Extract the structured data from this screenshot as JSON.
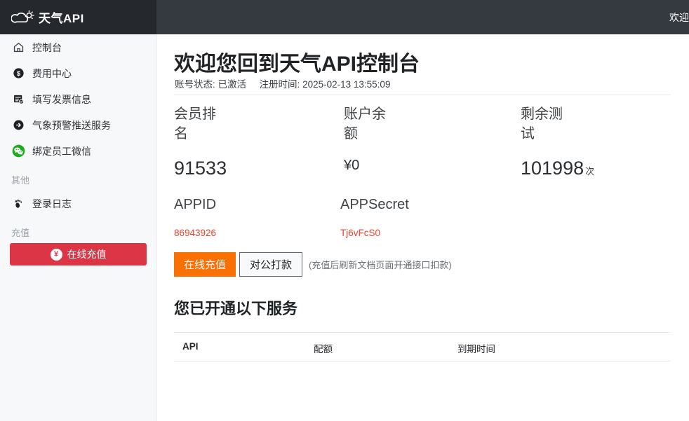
{
  "brand": {
    "name": "天气API",
    "icon": "cloud-sun-icon"
  },
  "topbar": {
    "greeting": "欢迎"
  },
  "sidebar": {
    "items": [
      {
        "label": "控制台",
        "icon": "home-icon"
      },
      {
        "label": "费用中心",
        "icon": "dollar-circle-icon"
      },
      {
        "label": "填写发票信息",
        "icon": "invoice-form-icon"
      },
      {
        "label": "气象预警推送服务",
        "icon": "arrow-right-circle-icon"
      },
      {
        "label": "绑定员工微信",
        "icon": "wechat-icon"
      }
    ],
    "group_other": "其他",
    "other_items": [
      {
        "label": "登录日志",
        "icon": "footprint-icon"
      }
    ],
    "group_recharge": "充值",
    "recharge_button": {
      "label": "在线充值",
      "icon": "yen-circle-icon",
      "color": "#dc3545"
    }
  },
  "main": {
    "title": "欢迎您回到天气API控制台",
    "meta": {
      "status_label": "账号状态:",
      "status_value": "已激活",
      "register_label": "注册时间:",
      "register_value": "2025-02-13 13:55:09"
    },
    "stats": [
      {
        "label": "会员排名",
        "value": "91533",
        "unit": ""
      },
      {
        "label": "账户余额",
        "value": "¥0",
        "unit": ""
      },
      {
        "label": "剩余测试",
        "value": "101998",
        "unit": "次"
      }
    ],
    "credentials": [
      {
        "label": "APPID",
        "value": "86943926"
      },
      {
        "label": "APPSecret",
        "value": "Tj6vFcS0"
      }
    ],
    "actions": {
      "primary": "在线充值",
      "secondary": "对公打款",
      "hint": "(充值后刷新文档页面开通接口扣款)"
    },
    "services": {
      "title": "您已开通以下服务",
      "columns": [
        "API",
        "配额",
        "到期时间"
      ],
      "rows": []
    }
  },
  "colors": {
    "topbar": "#343a40",
    "brandbar": "#25282c",
    "sidebar": "#f7f8fa",
    "accent_orange": "#f97105",
    "accent_red": "#dc3545",
    "credential_red": "#e8412b",
    "wechat_green": "#1aad19"
  }
}
